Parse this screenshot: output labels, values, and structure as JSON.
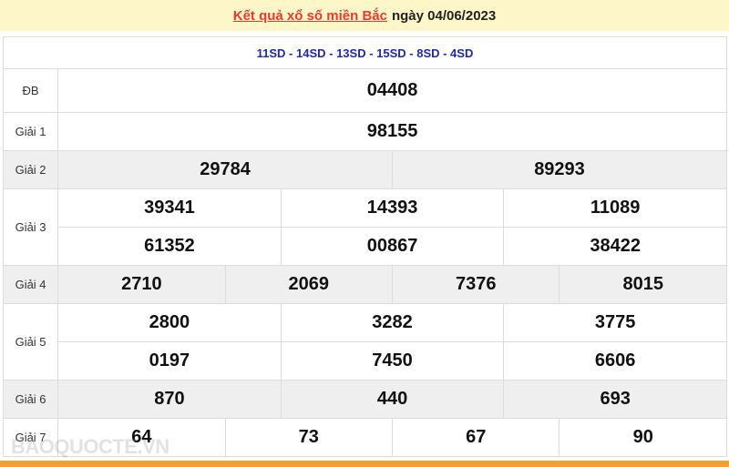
{
  "header": {
    "title_link": "Kết quả xổ số miền Bắc",
    "date_text": "ngày 04/06/2023"
  },
  "codes": "11SD - 14SD - 13SD - 15SD - 8SD - 4SD",
  "prizes": {
    "db": {
      "label": "ĐB",
      "numbers": [
        "04408"
      ]
    },
    "g1": {
      "label": "Giải 1",
      "numbers": [
        "98155"
      ]
    },
    "g2": {
      "label": "Giải 2",
      "numbers": [
        "29784",
        "89293"
      ]
    },
    "g3": {
      "label": "Giải 3",
      "numbers": [
        "39341",
        "14393",
        "11089",
        "61352",
        "00867",
        "38422"
      ]
    },
    "g4": {
      "label": "Giải 4",
      "numbers": [
        "2710",
        "2069",
        "7376",
        "8015"
      ]
    },
    "g5": {
      "label": "Giải 5",
      "numbers": [
        "2800",
        "3282",
        "3775",
        "0197",
        "7450",
        "6606"
      ]
    },
    "g6": {
      "label": "Giải 6",
      "numbers": [
        "870",
        "440",
        "693"
      ]
    },
    "g7": {
      "label": "Giải 7",
      "numbers": [
        "64",
        "73",
        "67",
        "90"
      ]
    }
  },
  "watermark": "BAOQUOCTE.VN",
  "colors": {
    "header_bg": "#fdf6c8",
    "accent_red": "#e8392f",
    "code_blue": "#1f2aa3",
    "shaded_row": "#efefef",
    "bottom_bar": "#f2a13a"
  }
}
